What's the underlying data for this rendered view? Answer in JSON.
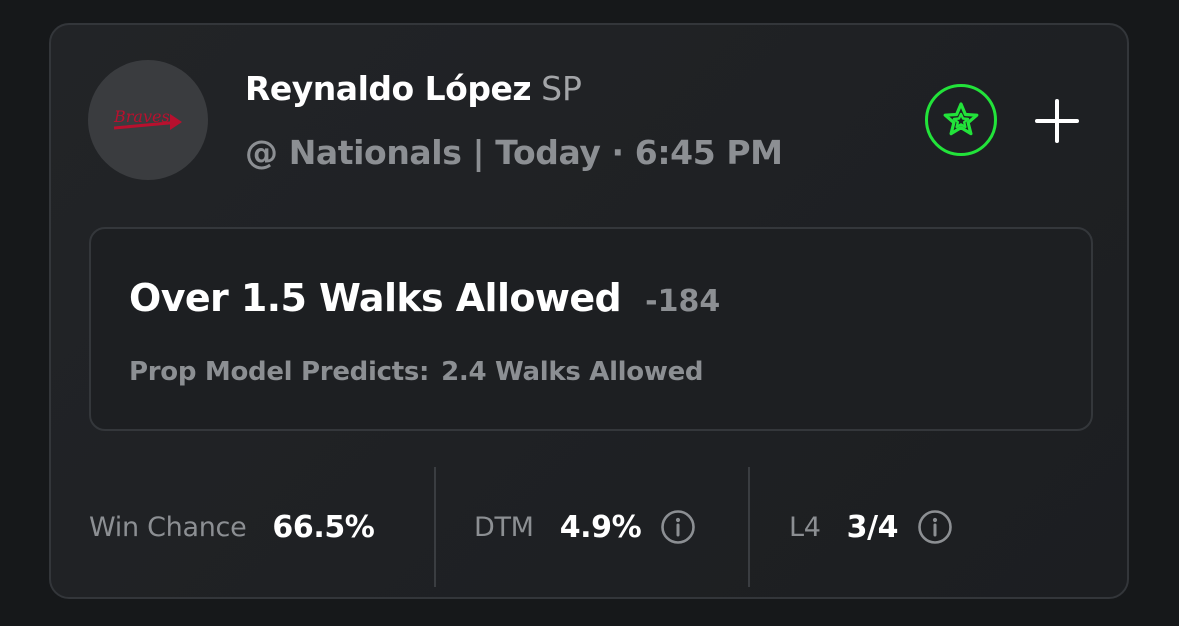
{
  "player": {
    "name": "Reynaldo López",
    "position": "SP",
    "game_info": "@ Nationals | Today · 6:45 PM",
    "team_logo_text": "Braves"
  },
  "actions": {
    "favorite_icon": "star-icon",
    "add_icon": "plus-icon"
  },
  "prop": {
    "label": "Over 1.5 Walks Allowed",
    "odds": "-184",
    "predict_label": "Prop Model Predicts:",
    "predict_value": "2.4 Walks Allowed"
  },
  "stats": [
    {
      "label": "Win Chance",
      "value": "66.5%",
      "info": false
    },
    {
      "label": "DTM",
      "value": "4.9%",
      "info": true
    },
    {
      "label": "L4",
      "value": "3/4",
      "info": true
    }
  ],
  "colors": {
    "background": "#16181a",
    "card": "#222427",
    "accent_green": "#22e33a",
    "muted_text": "#8c8f93",
    "logo_red": "#b8102e",
    "logo_navy": "#13274f"
  }
}
